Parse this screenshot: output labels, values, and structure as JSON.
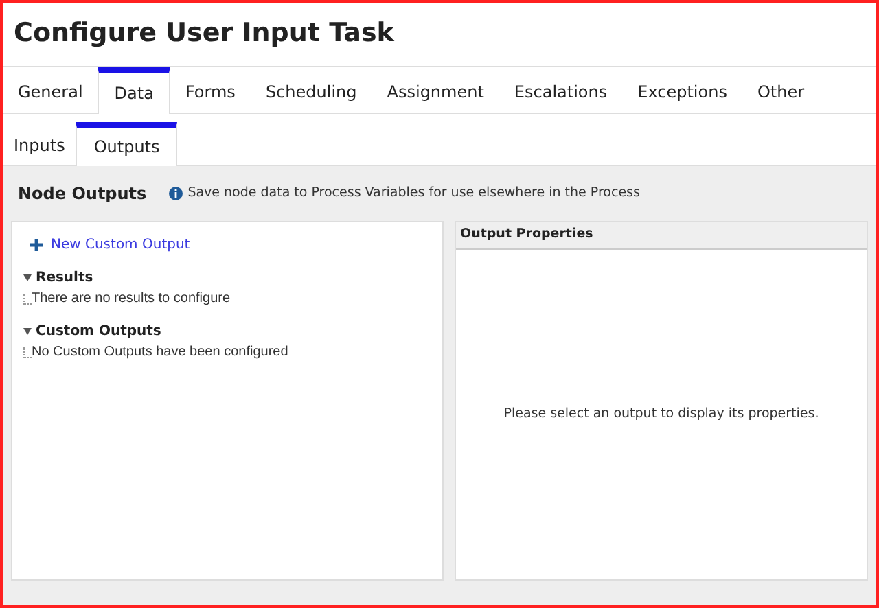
{
  "window": {
    "title": "Configure User Input Task"
  },
  "tabs": [
    {
      "label": "General",
      "selected": false
    },
    {
      "label": "Data",
      "selected": true
    },
    {
      "label": "Forms",
      "selected": false
    },
    {
      "label": "Scheduling",
      "selected": false
    },
    {
      "label": "Assignment",
      "selected": false
    },
    {
      "label": "Escalations",
      "selected": false
    },
    {
      "label": "Exceptions",
      "selected": false
    },
    {
      "label": "Other",
      "selected": false
    }
  ],
  "subtabs": [
    {
      "label": "Inputs",
      "selected": false
    },
    {
      "label": "Outputs",
      "selected": true
    }
  ],
  "section": {
    "title": "Node Outputs",
    "info": "Save node data to Process Variables for use elsewhere in the Process"
  },
  "outputs_panel": {
    "new_button": "New Custom Output",
    "groups": [
      {
        "title": "Results",
        "expanded": true,
        "children": [
          {
            "label": "There are no results to configure"
          }
        ]
      },
      {
        "title": "Custom Outputs",
        "expanded": true,
        "children": [
          {
            "label": "No Custom Outputs have been configured"
          }
        ]
      }
    ]
  },
  "properties_panel": {
    "title": "Output Properties",
    "message": "Please select an output to display its properties."
  }
}
